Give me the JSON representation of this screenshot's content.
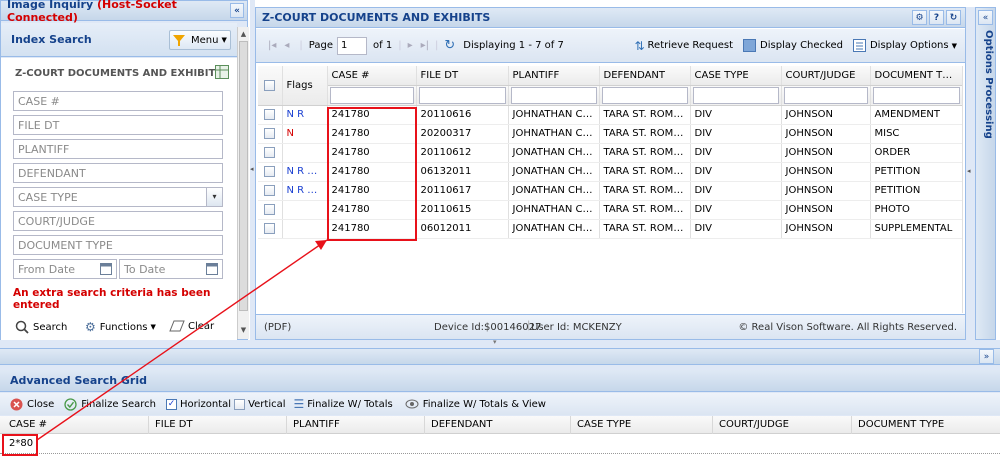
{
  "left_panel": {
    "title": "Image Inquiry",
    "status": "(Host-Socket Connected)",
    "index_search_label": "Index Search",
    "menu_label": "Menu",
    "section_title": "Z-COURT DOCUMENTS AND EXHIBITS",
    "fields": {
      "case": "CASE #",
      "file_dt": "FILE DT",
      "plantiff": "PLANTIFF",
      "defendant": "DEFENDANT",
      "case_type": "CASE TYPE",
      "court_judge": "COURT/JUDGE",
      "document_type": "DOCUMENT TYPE",
      "from_date": "From Date",
      "to_date": "To Date"
    },
    "error": "An extra search criteria has been entered",
    "search_label": "Search",
    "functions_label": "Functions",
    "clear_label": "Clear"
  },
  "grid_panel": {
    "title": "Z-COURT DOCUMENTS AND EXHIBITS",
    "page_label": "Page",
    "page_value": "1",
    "of_label": "of 1",
    "displaying": "Displaying 1 - 7 of 7",
    "retrieve_label": "Retrieve Request",
    "display_checked_label": "Display Checked",
    "display_options_label": "Display Options",
    "columns": [
      "Flags",
      "CASE #",
      "FILE DT",
      "PLANTIFF",
      "DEFENDANT",
      "CASE TYPE",
      "COURT/JUDGE",
      "DOCUMENT TYPE"
    ],
    "rows": [
      {
        "flags": "N R",
        "flag_color": "#1a3fd1",
        "case": "241780",
        "file_dt": "20110616",
        "plantiff": "JOHNATHAN CH...",
        "defendant": "TARA ST. ROMA...",
        "case_type": "DIV",
        "judge": "JOHNSON",
        "doc_type": "AMENDMENT"
      },
      {
        "flags": "N",
        "flag_color": "#d40000",
        "case": "241780",
        "file_dt": "20200317",
        "plantiff": "JOHNATHAN CH...",
        "defendant": "TARA ST. ROMA...",
        "case_type": "DIV",
        "judge": "JOHNSON",
        "doc_type": "MISC"
      },
      {
        "flags": "",
        "flag_color": "#1a3fd1",
        "case": "241780",
        "file_dt": "20110612",
        "plantiff": "JONATHAN CHA...",
        "defendant": "TARA ST. ROMA...",
        "case_type": "DIV",
        "judge": "JOHNSON",
        "doc_type": "ORDER"
      },
      {
        "flags": "N R S...",
        "flag_color": "#1a3fd1",
        "case": "241780",
        "file_dt": "06132011",
        "plantiff": "JONATHAN CHA...",
        "defendant": "TARA ST. ROMA...",
        "case_type": "DIV",
        "judge": "JOHNSON",
        "doc_type": "PETITION"
      },
      {
        "flags": "N R S...",
        "flag_color": "#1a3fd1",
        "case": "241780",
        "file_dt": "20110617",
        "plantiff": "JONATHAN CHA...",
        "defendant": "TARA ST. ROMA...",
        "case_type": "DIV",
        "judge": "JOHNSON",
        "doc_type": "PETITION"
      },
      {
        "flags": "",
        "flag_color": "#1a3fd1",
        "case": "241780",
        "file_dt": "20110615",
        "plantiff": "JOHNATHAN CH...",
        "defendant": "TARA ST. ROMA...",
        "case_type": "DIV",
        "judge": "JOHNSON",
        "doc_type": "PHOTO"
      },
      {
        "flags": "",
        "flag_color": "#1a3fd1",
        "case": "241780",
        "file_dt": "06012011",
        "plantiff": "JONATHAN CHA...",
        "defendant": "TARA ST. ROMA...",
        "case_type": "DIV",
        "judge": "JOHNSON",
        "doc_type": "SUPPLEMENTAL"
      }
    ],
    "footer_left": "(PDF)",
    "footer_device": "Device Id:$00146027",
    "footer_user": "User Id: MCKENZY",
    "footer_right": "© Real Vison Software. All Rights Reserved."
  },
  "right_panel": {
    "title": "Options Processing"
  },
  "advanced": {
    "title": "Advanced Search Grid",
    "close_label": "Close",
    "finalize_label": "Finalize Search",
    "horizontal_label": "Horizontal",
    "vertical_label": "Vertical",
    "totals_label": "Finalize W/ Totals",
    "totals_view_label": "Finalize W/ Totals & View",
    "columns": [
      "CASE #",
      "FILE DT",
      "PLANTIFF",
      "DEFENDANT",
      "CASE TYPE",
      "COURT/JUDGE",
      "DOCUMENT TYPE"
    ],
    "row_value": "2*80"
  },
  "colors": {
    "header_text": "#15428b",
    "error_red": "#d40000",
    "highlight_red": "#e8111a",
    "panel_border": "#99bbe8"
  }
}
